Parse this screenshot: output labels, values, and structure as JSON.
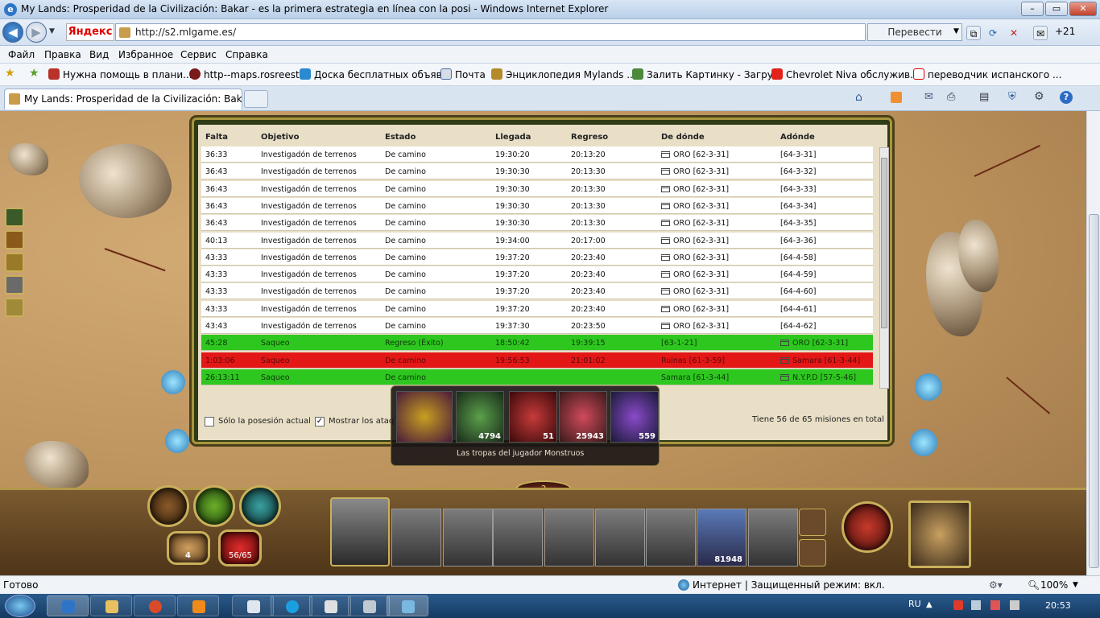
{
  "window": {
    "title": "My Lands: Prosperidad de la Civilización: Bakar - es la primera estrategia en línea con la posi - Windows Internet Explorer",
    "url": "http://s2.mlgame.es/",
    "yandex": "Яндекс",
    "translate_label": "Перевести",
    "notif_count": "+21"
  },
  "menu": [
    "Файл",
    "Правка",
    "Вид",
    "Избранное",
    "Сервис",
    "Справка"
  ],
  "favorites": [
    "Нужна помощь в плани...",
    "http--maps.rosreestr",
    "Доска бесплатных объяв...",
    "Почта",
    "Энциклопедия Mylands ...",
    "Залить Картинку - Загру...",
    "Chevrolet Niva обслужив...",
    "переводчик испанского ..."
  ],
  "tab": {
    "title": "My Lands: Prosperidad de la Civilización: Bakar - ..."
  },
  "table": {
    "headers": [
      "Falta",
      "Objetivo",
      "Estado",
      "Llegada",
      "Regreso",
      "De dónde",
      "Adónde"
    ],
    "rows": [
      [
        "36:33",
        "Investigadón de terrenos",
        "De camino",
        "19:30:20",
        "20:13:20",
        "ORO [62-3-31]",
        "[64-3-31]"
      ],
      [
        "36:43",
        "Investigadón de terrenos",
        "De camino",
        "19:30:30",
        "20:13:30",
        "ORO [62-3-31]",
        "[64-3-32]"
      ],
      [
        "36:43",
        "Investigadón de terrenos",
        "De camino",
        "19:30:30",
        "20:13:30",
        "ORO [62-3-31]",
        "[64-3-33]"
      ],
      [
        "36:43",
        "Investigadón de terrenos",
        "De camino",
        "19:30:30",
        "20:13:30",
        "ORO [62-3-31]",
        "[64-3-34]"
      ],
      [
        "36:43",
        "Investigadón de terrenos",
        "De camino",
        "19:30:30",
        "20:13:30",
        "ORO [62-3-31]",
        "[64-3-35]"
      ],
      [
        "40:13",
        "Investigadón de terrenos",
        "De camino",
        "19:34:00",
        "20:17:00",
        "ORO [62-3-31]",
        "[64-3-36]"
      ],
      [
        "43:33",
        "Investigadón de terrenos",
        "De camino",
        "19:37:20",
        "20:23:40",
        "ORO [62-3-31]",
        "[64-4-58]"
      ],
      [
        "43:33",
        "Investigadón de terrenos",
        "De camino",
        "19:37:20",
        "20:23:40",
        "ORO [62-3-31]",
        "[64-4-59]"
      ],
      [
        "43:33",
        "Investigadón de terrenos",
        "De camino",
        "19:37:20",
        "20:23:40",
        "ORO [62-3-31]",
        "[64-4-60]"
      ],
      [
        "43:33",
        "Investigadón de terrenos",
        "De camino",
        "19:37:20",
        "20:23:40",
        "ORO [62-3-31]",
        "[64-4-61]"
      ],
      [
        "43:43",
        "Investigadón de terrenos",
        "De camino",
        "19:37:30",
        "20:23:50",
        "ORO [62-3-31]",
        "[64-4-62]"
      ],
      [
        "45:28",
        "Saqueo",
        "Regreso (Éxito)",
        "18:50:42",
        "19:39:15",
        "[63-1-21]",
        "ORO [62-3-31]"
      ],
      [
        "1:03:06",
        "Saqueo",
        "De camino",
        "19:56:53",
        "21:01:02",
        "Ruinas [61-3-59]",
        "Samara [61-3-44]"
      ],
      [
        "26:13:11",
        "Saqueo",
        "De camino",
        "",
        "",
        "Samara [61-3-44]",
        "N.Y.P.D [57-5-46]"
      ]
    ],
    "row_colors": [
      "white",
      "white",
      "white",
      "white",
      "white",
      "white",
      "white",
      "white",
      "white",
      "white",
      "white",
      "green",
      "red",
      "green"
    ]
  },
  "filters": {
    "only_current": "Sólo la posesión actual",
    "show_attacks": "Mostrar los ataq",
    "only_current_checked": false,
    "show_attacks_checked": true
  },
  "total_text": "Tiene 56 de 65 misiones en total",
  "popup": {
    "caption": "Las tropas del jugador Monstruos",
    "counts": [
      "4794",
      "51",
      "25943",
      "559"
    ]
  },
  "hud": {
    "mail_count": "4",
    "missions": "56/65",
    "unit_count": "81948"
  },
  "status": {
    "left": "Готово",
    "zone": "Интернет | Защищенный режим: вкл.",
    "zoom": "100%"
  },
  "taskbar": {
    "lang": "RU",
    "time": "20:53"
  },
  "colors": {
    "row_green": "#2dc71f",
    "row_red": "#e41717",
    "frame": "#a8953f"
  }
}
